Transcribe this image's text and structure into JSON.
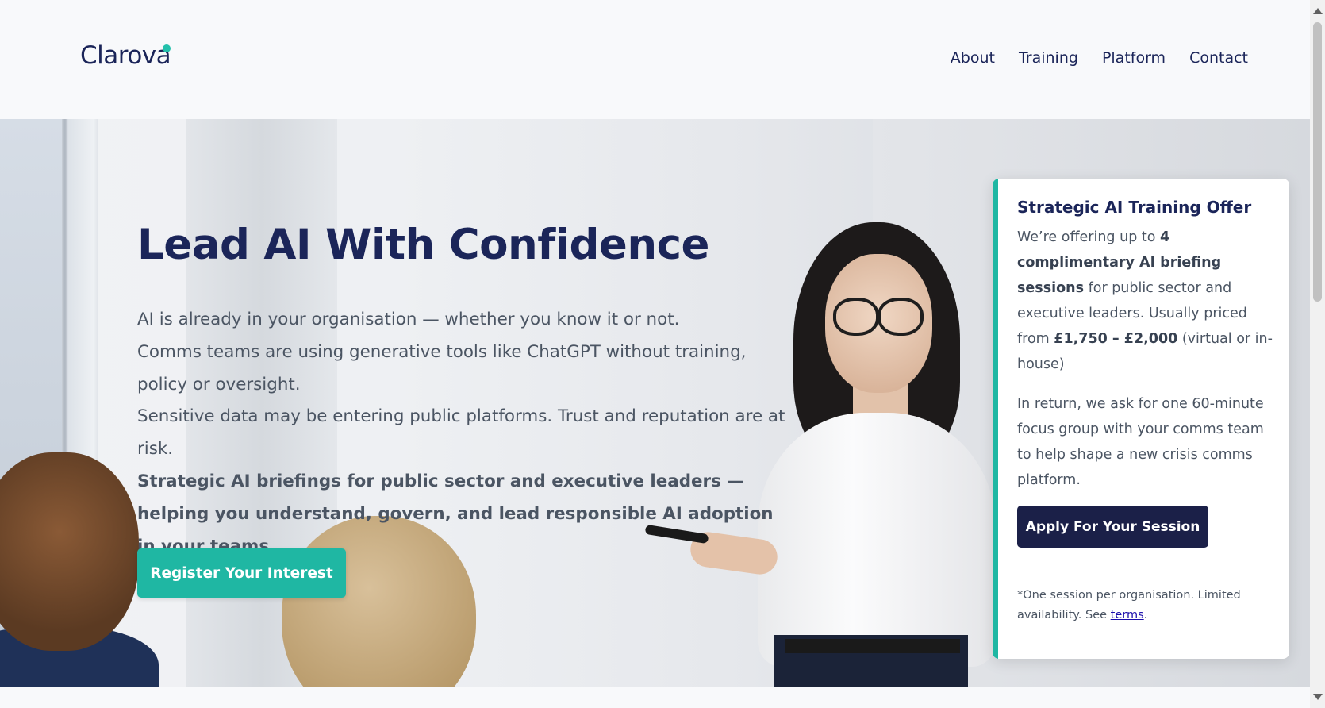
{
  "header": {
    "logo": "Clarova",
    "nav": [
      "About",
      "Training",
      "Platform",
      "Contact"
    ]
  },
  "hero": {
    "title": "Lead AI With Confidence",
    "paragraphs": [
      "AI is already in your organisation — whether you know it or not.",
      "Comms teams are using generative tools like ChatGPT without training, policy or oversight.",
      "Sensitive data may be entering public platforms. Trust and reputation are at risk.",
      "Strategic AI briefings for public sector and executive leaders — helping you understand, govern, and lead responsible AI adoption in your teams."
    ],
    "cta_label": "Register Your Interest"
  },
  "offer_card": {
    "title": "Strategic AI Training Offer",
    "p1": {
      "t1": "We’re offering up to ",
      "b1": "4 complimentary AI briefing sessions",
      "t2": " for public sector and executive leaders. Usually priced from ",
      "b2": "£1,750 – £2,000",
      "t3": " (virtual or in-house)"
    },
    "p2": "In return, we ask for one 60-minute focus group with your comms team to help shape a new crisis comms platform.",
    "button_label": "Apply For Your Session",
    "note_text": "*One session per organisation. Limited availability. See ",
    "note_link": "terms",
    "note_end": "."
  },
  "colors": {
    "navy": "#1b2559",
    "teal": "#1fb7a3",
    "button_dark": "#1b2048",
    "body_text": "#4b5563"
  },
  "icons": {
    "logo_dot": "teal-dot",
    "scroll_up": "triangle-up",
    "scroll_down": "triangle-down"
  }
}
